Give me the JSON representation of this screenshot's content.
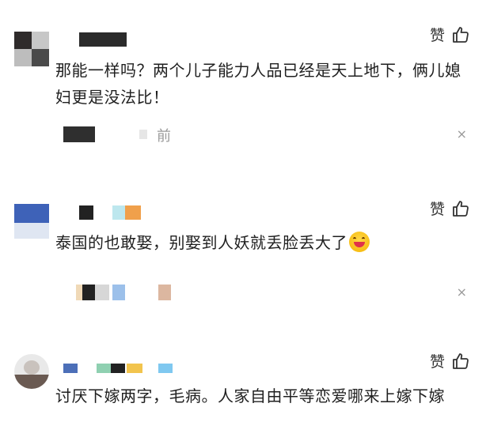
{
  "comments": [
    {
      "text": "那能一样吗？两个儿子能力人品已经是天上地下，俩儿媳妇更是没法比！",
      "like_label": "赞",
      "reply_time_fragment": "前",
      "close_glyph": "×"
    },
    {
      "text": "泰国的也敢娶，别娶到人妖就丢脸丢大了",
      "like_label": "赞",
      "close_glyph": "×"
    },
    {
      "text": "讨厌下嫁两字，毛病。人家自由平等恋爱哪来上嫁下嫁",
      "like_label": "赞"
    }
  ],
  "colors": {
    "text": "#1f1f1f",
    "muted": "#9a9a9a",
    "background": "#ffffff"
  },
  "icons": {
    "like": "thumbs-up-icon",
    "close": "close-icon",
    "emoji": "grinning-face-emoji-icon"
  }
}
